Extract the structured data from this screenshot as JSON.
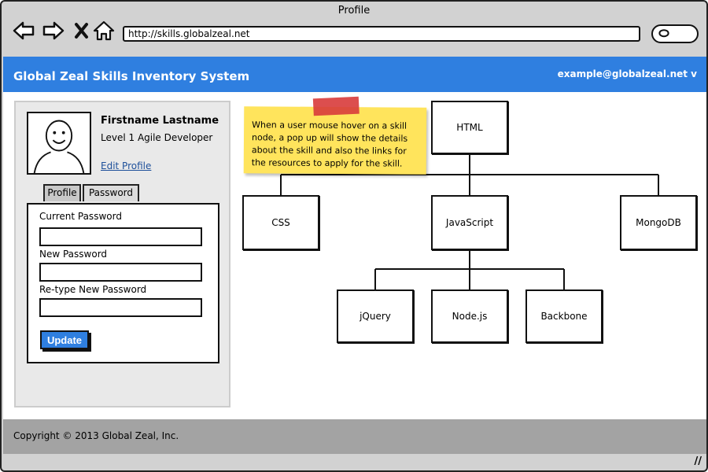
{
  "window": {
    "title": "Profile"
  },
  "browser": {
    "url": "http://skills.globalzeal.net",
    "icons": [
      "back-arrow-icon",
      "forward-arrow-icon",
      "close-x-icon",
      "home-icon",
      "search-icon"
    ]
  },
  "header": {
    "title": "Global Zeal Skills Inventory System",
    "user_menu": "example@globalzeal.net v"
  },
  "profile": {
    "name": "Firstname Lastname",
    "role": "Level 1 Agile Developer",
    "edit_link": "Edit Profile"
  },
  "tabs": [
    {
      "label": "Profile"
    },
    {
      "label": "Password",
      "selected": true
    }
  ],
  "password_form": {
    "current_label": "Current Password",
    "current_value": "",
    "new_label": "New Password",
    "new_value": "",
    "retype_label": "Re-type New Password",
    "retype_value": "",
    "update_label": "Update"
  },
  "sticky_note": {
    "text": "When a user mouse hover on a skill node, a pop up will show the details about the skill and also the links for the resources to apply for the skill."
  },
  "skill_tree": {
    "root": "HTML",
    "level1": [
      "CSS",
      "JavaScript",
      "MongoDB"
    ],
    "javascript_children": [
      "jQuery",
      "Node.js",
      "Backbone"
    ]
  },
  "footer": {
    "copyright": "Copyright © 2013 Global Zeal, Inc."
  },
  "colors": {
    "accent": "#2f7fe0",
    "frame": "#d2d2d2",
    "footer": "#a3a3a3",
    "note": "#ffe45c",
    "tape": "#d83b3b",
    "link": "#1d4f9a"
  }
}
